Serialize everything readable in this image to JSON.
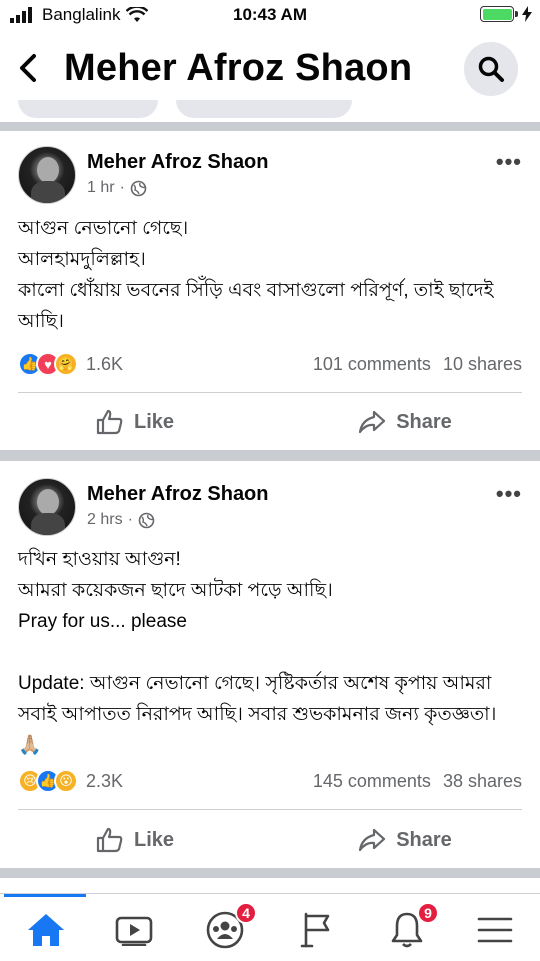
{
  "status": {
    "carrier": "Banglalink",
    "time": "10:43 AM"
  },
  "header": {
    "title": "Meher Afroz Shaon"
  },
  "posts": [
    {
      "author": "Meher Afroz Shaon",
      "time": "1 hr",
      "lines": [
        "আগুন নেভানো গেছে।",
        "আলহামদুলিল্লাহ।",
        "কালো ধোঁয়ায় ভবনের সিঁড়ি এবং বাসাগুলো পরিপূর্ণ, তাই ছাদেই আছি।"
      ],
      "reaction_icons": [
        "like-icon",
        "love-icon",
        "care-icon"
      ],
      "reactions": "1.6K",
      "comments": "101 comments",
      "shares": "10 shares",
      "like_label": "Like",
      "share_label": "Share"
    },
    {
      "author": "Meher Afroz Shaon",
      "time": "2 hrs",
      "lines": [
        "দখিন হাওয়ায় আগুন!",
        "আমরা কয়েকজন ছাদে আটকা পড়ে আছি।",
        "Pray for us... please",
        "",
        "Update: আগুন নেভানো গেছে। সৃষ্টিকর্তার অশেষ কৃপায় আমরা সবাই আপাতত নিরাপদ আছি। সবার শুভকামনার জন্য কৃতজ্ঞতা।",
        "🙏🏼"
      ],
      "reaction_icons": [
        "sad-icon",
        "like-icon",
        "wow-icon"
      ],
      "reactions": "2.3K",
      "comments": "145 comments",
      "shares": "38 shares",
      "like_label": "Like",
      "share_label": "Share"
    }
  ],
  "bottom_nav": {
    "groups_badge": "4",
    "notifications_badge": "9"
  },
  "colors": {
    "accent": "#1877f2",
    "badge": "#e41e3f",
    "battery": "#4cd964"
  }
}
